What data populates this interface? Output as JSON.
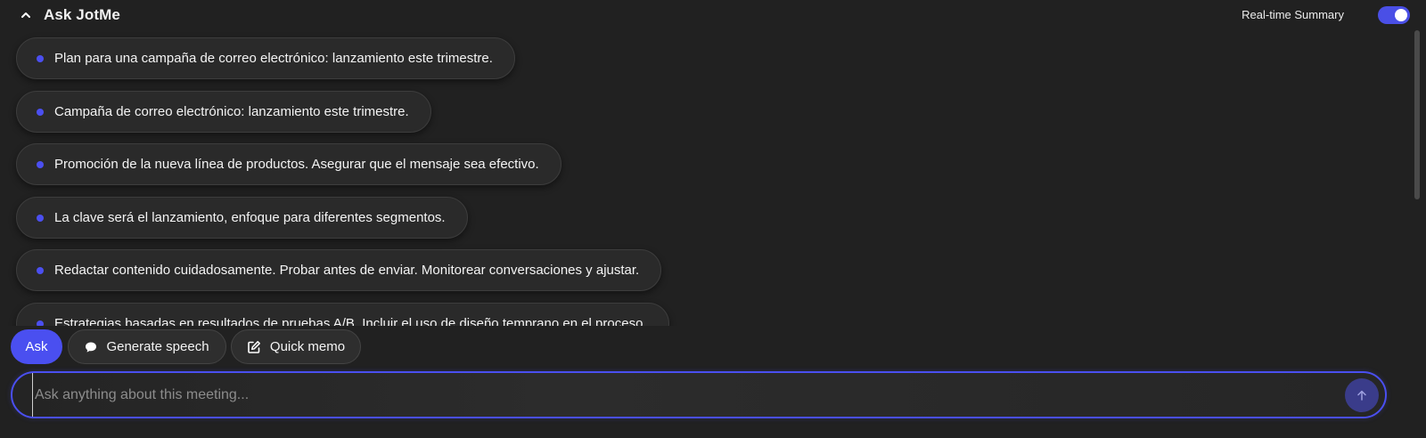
{
  "header": {
    "title": "Ask JotMe",
    "collapse_icon": "chevron-up-icon",
    "realtime_summary_label": "Real-time Summary",
    "realtime_summary_enabled": true
  },
  "summary_items": [
    {
      "text": "Plan para una campaña de correo electrónico: lanzamiento este trimestre."
    },
    {
      "text": "Campaña de correo electrónico: lanzamiento este trimestre."
    },
    {
      "text": "Promoción de la nueva línea de productos. Asegurar que el mensaje sea efectivo."
    },
    {
      "text": "La clave será el lanzamiento, enfoque para diferentes segmentos."
    },
    {
      "text": "Redactar contenido cuidadosamente. Probar antes de enviar. Monitorear conversaciones y ajustar."
    },
    {
      "text": "Estrategias basadas en resultados de pruebas A/B. Incluir el uso de diseño temprano en el proceso."
    }
  ],
  "actions": {
    "ask_label": "Ask",
    "speech_label": "Generate speech",
    "speech_icon": "speech-bubble-icon",
    "memo_label": "Quick memo",
    "memo_icon": "edit-note-icon"
  },
  "input": {
    "placeholder": "Ask anything about this meeting...",
    "value": "",
    "send_icon": "arrow-up-icon"
  },
  "colors": {
    "accent": "#4a4ff0",
    "background": "#212121",
    "pill_background": "#2a2a2a"
  }
}
